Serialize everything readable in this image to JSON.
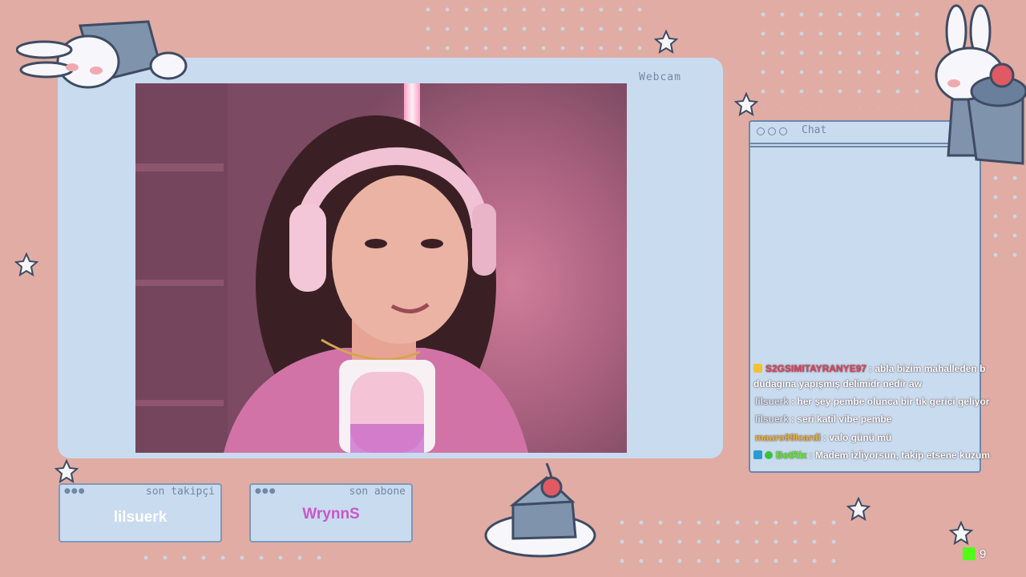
{
  "webcam": {
    "label": "Webcam"
  },
  "chat": {
    "title": "Chat",
    "messages": [
      {
        "user": "S2GSIMITAYRANYE97",
        "user_color": "#e0435a",
        "badge": "crown",
        "text": ": abla bizim mahalleden b",
        "cont": "dudagına yapışmış delimidr nedir aw"
      },
      {
        "user": "lilsuerk",
        "user_color": "#dbe3f1",
        "text": ": her şey pembe olunca bir tık gerici geliyor"
      },
      {
        "user": "lilsuerk",
        "user_color": "#dbe3f1",
        "text": ": seri katil vibe pembe"
      },
      {
        "user": "mauro09Icardi",
        "user_color": "#f0b233",
        "text": ": valo günü mü"
      },
      {
        "user": "BotRix",
        "user_color": "#53fc18",
        "badge": "bot",
        "text": ": Madem izliyorsun, takip etsene kuzum"
      }
    ]
  },
  "last_follower": {
    "title": "son takipçi",
    "name": "lilsuerk",
    "color": "#ffffff"
  },
  "last_sub": {
    "title": "son abone",
    "name": "WrynnS",
    "color": "#c957c8"
  },
  "viewers": {
    "count": "9",
    "accent": "#53fc18"
  }
}
